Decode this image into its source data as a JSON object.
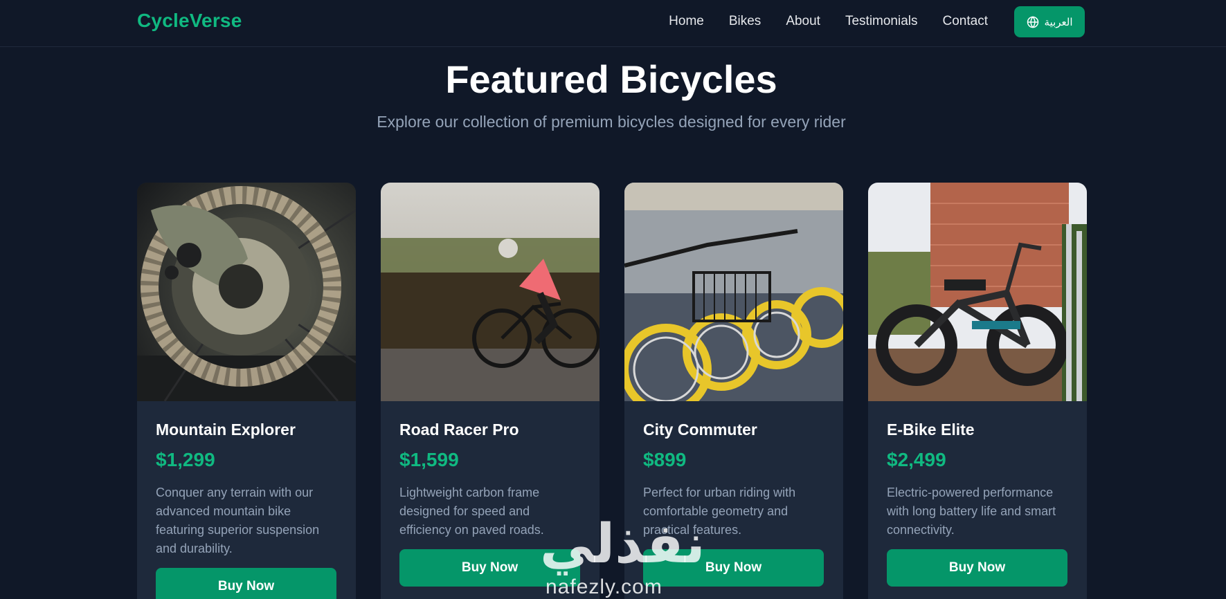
{
  "header": {
    "logo": "CycleVerse",
    "nav": [
      "Home",
      "Bikes",
      "About",
      "Testimonials",
      "Contact"
    ],
    "language_button": "العربية",
    "language_icon": "globe-icon"
  },
  "section": {
    "title": "Featured Bicycles",
    "subtitle": "Explore our collection of premium bicycles designed for every rider"
  },
  "products": [
    {
      "name": "Mountain Explorer",
      "price": "$1,299",
      "description": "Conquer any terrain with our advanced mountain bike featuring superior suspension and durability.",
      "button": "Buy Now",
      "image": "disc-brake-closeup-image"
    },
    {
      "name": "Road Racer Pro",
      "price": "$1,599",
      "description": "Lightweight carbon frame designed for speed and efficiency on paved roads.",
      "button": "Buy Now",
      "image": "road-cyclist-image"
    },
    {
      "name": "City Commuter",
      "price": "$899",
      "description": "Perfect for urban riding with comfortable geometry and practical features.",
      "button": "Buy Now",
      "image": "yellow-city-bikes-image"
    },
    {
      "name": "E-Bike Elite",
      "price": "$2,499",
      "description": "Electric-powered performance with long battery life and smart connectivity.",
      "button": "Buy Now",
      "image": "parked-ebikes-image"
    }
  ],
  "watermark": {
    "arabic": "نفذلي",
    "latin": "nafezly.com"
  },
  "colors": {
    "background": "#101828",
    "card": "#1e293b",
    "accent": "#10b981",
    "button": "#059669"
  }
}
